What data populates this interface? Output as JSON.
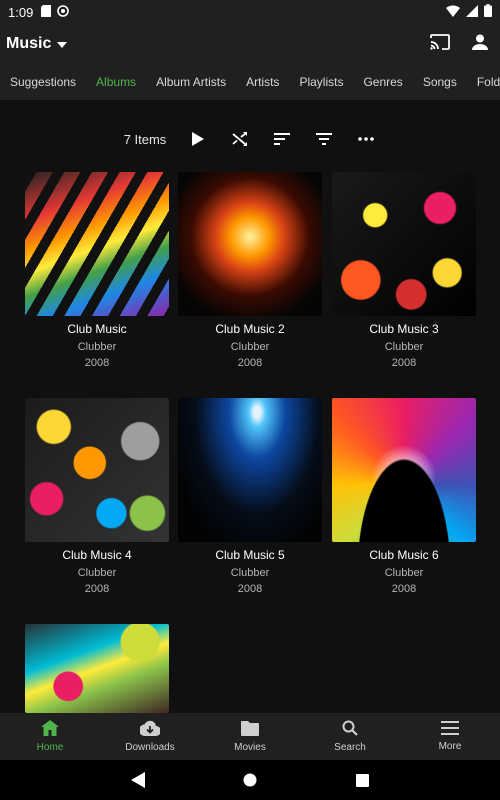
{
  "status": {
    "time": "1:09",
    "icons_left": [
      "sd-card-icon",
      "sync-icon"
    ],
    "icons_right": [
      "wifi-icon",
      "signal-icon",
      "battery-icon"
    ]
  },
  "app_bar": {
    "title": "Music",
    "actions": [
      "cast-icon",
      "user-icon"
    ]
  },
  "tabs": [
    {
      "label": "Suggestions",
      "active": false
    },
    {
      "label": "Albums",
      "active": true
    },
    {
      "label": "Album Artists",
      "active": false
    },
    {
      "label": "Artists",
      "active": false
    },
    {
      "label": "Playlists",
      "active": false
    },
    {
      "label": "Genres",
      "active": false
    },
    {
      "label": "Songs",
      "active": false
    },
    {
      "label": "Folders",
      "active": false
    }
  ],
  "toolbar": {
    "item_count": "7 Items",
    "buttons": [
      "play-icon",
      "shuffle-icon",
      "sort-icon",
      "filter-icon",
      "more-icon"
    ]
  },
  "albums": [
    {
      "title": "Club Music",
      "artist": "Clubber",
      "year": "2008"
    },
    {
      "title": "Club Music 2",
      "artist": "Clubber",
      "year": "2008"
    },
    {
      "title": "Club Music 3",
      "artist": "Clubber",
      "year": "2008"
    },
    {
      "title": "Club Music 4",
      "artist": "Clubber",
      "year": "2008"
    },
    {
      "title": "Club Music 5",
      "artist": "Clubber",
      "year": "2008"
    },
    {
      "title": "Club Music 6",
      "artist": "Clubber",
      "year": "2008"
    },
    {
      "title": "",
      "artist": "",
      "year": ""
    }
  ],
  "bottom_nav": [
    {
      "label": "Home",
      "icon": "home-icon",
      "active": true
    },
    {
      "label": "Downloads",
      "icon": "download-icon",
      "active": false
    },
    {
      "label": "Movies",
      "icon": "folder-icon",
      "active": false
    },
    {
      "label": "Search",
      "icon": "search-icon",
      "active": false
    },
    {
      "label": "More",
      "icon": "menu-icon",
      "active": false
    }
  ],
  "colors": {
    "accent": "#52b54b",
    "background": "#101010",
    "bar": "#202020"
  }
}
